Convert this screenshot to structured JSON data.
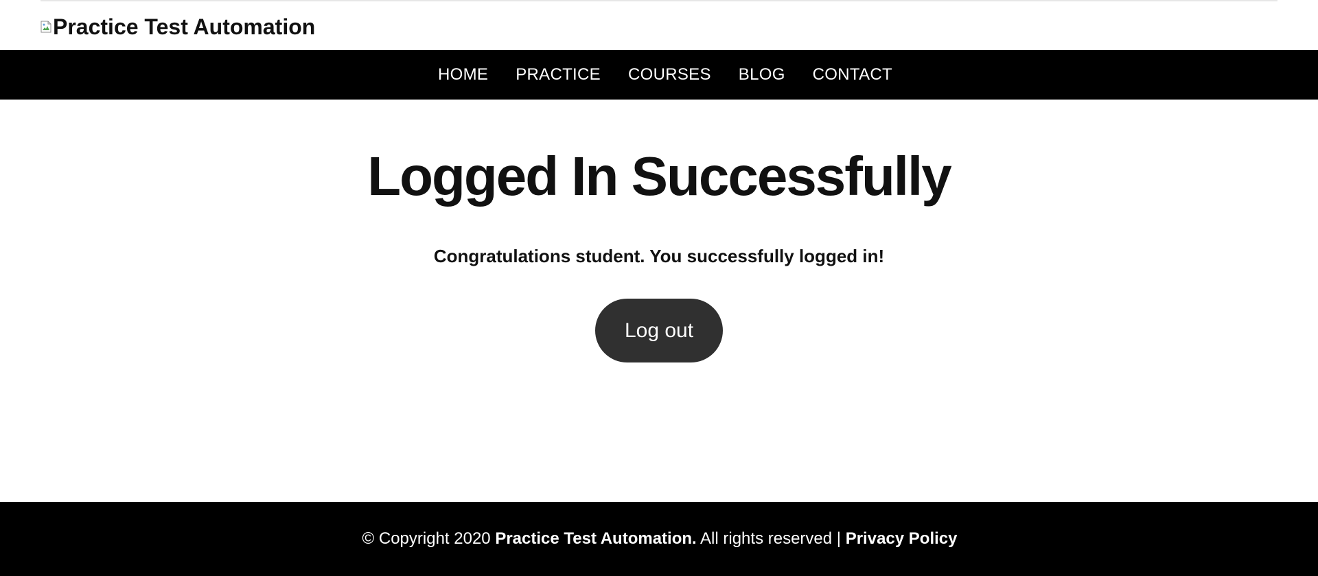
{
  "header": {
    "logo_text": "Practice Test Automation",
    "logo_icon": "broken-image-icon"
  },
  "nav": {
    "items": [
      {
        "label": "HOME"
      },
      {
        "label": "PRACTICE"
      },
      {
        "label": "COURSES"
      },
      {
        "label": "BLOG"
      },
      {
        "label": "CONTACT"
      }
    ]
  },
  "main": {
    "title": "Logged In Successfully",
    "message": "Congratulations student. You successfully logged in!",
    "logout_label": "Log out"
  },
  "footer": {
    "copyright_prefix": "© Copyright 2020",
    "brand": "Practice Test Automation.",
    "rights": "All rights reserved |",
    "privacy_label": "Privacy Policy"
  },
  "colors": {
    "nav_background": "#000000",
    "button_background": "#303030",
    "text": "#111111",
    "inverse_text": "#ffffff"
  }
}
